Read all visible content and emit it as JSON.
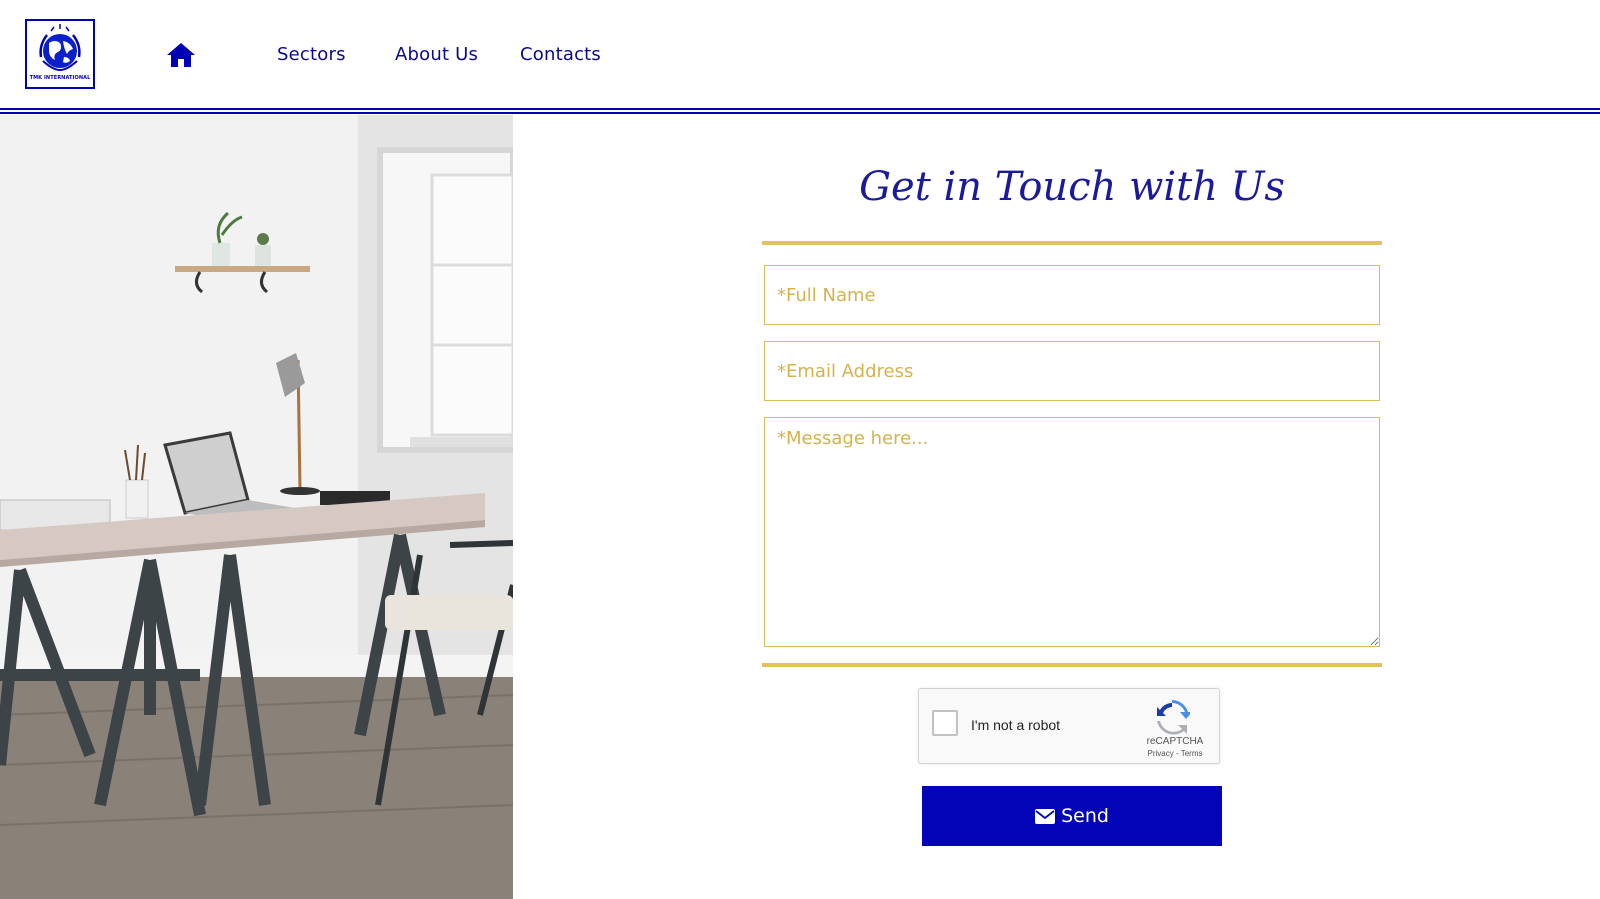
{
  "header": {
    "logo_text": "TMK INTERNATIONAL",
    "home_icon": "home-icon",
    "nav": [
      {
        "label": "Sectors"
      },
      {
        "label": "About Us"
      },
      {
        "label": "Contacts"
      }
    ]
  },
  "contact": {
    "title": "Get in Touch with Us",
    "fields": {
      "name_placeholder": "*Full Name",
      "email_placeholder": "*Email Address",
      "message_placeholder": "*Message here..."
    },
    "captcha": {
      "label": "I'm not a robot",
      "brand": "reCAPTCHA",
      "terms": "Privacy - Terms"
    },
    "send_label": "Send",
    "send_icon": "envelope-icon"
  },
  "colors": {
    "brand_blue": "#0303b7",
    "nav_text": "#0a0a8a",
    "gold": "#e2c25f"
  }
}
